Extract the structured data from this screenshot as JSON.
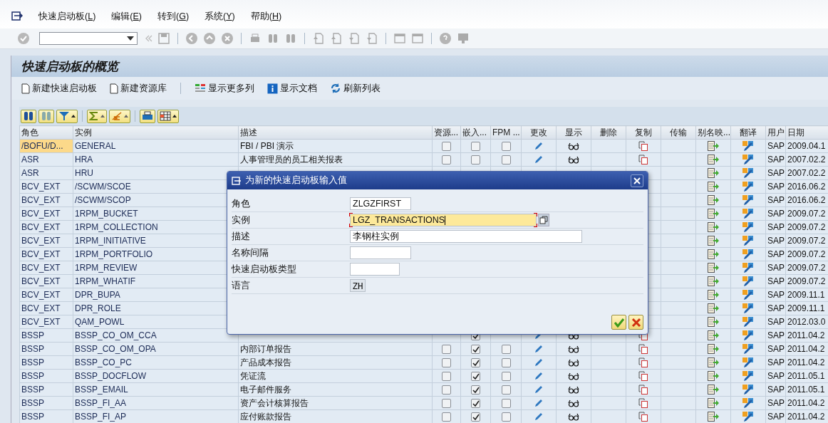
{
  "menu": [
    {
      "label": "快速启动板(L)"
    },
    {
      "label": "编辑(E)"
    },
    {
      "label": "转到(G)"
    },
    {
      "label": "系统(Y)"
    },
    {
      "label": "帮助(H)"
    }
  ],
  "title": "快速启动板的概览",
  "app_toolbar": [
    {
      "kind": "new",
      "label": "新建快速启动板"
    },
    {
      "kind": "new",
      "label": "新建资源库"
    },
    {
      "kind": "columns",
      "label": "显示更多列"
    },
    {
      "kind": "info",
      "label": "显示文档"
    },
    {
      "kind": "refresh",
      "label": "刷新列表"
    }
  ],
  "table": {
    "columns": [
      "角色",
      "实例",
      "描述",
      "资源...",
      "嵌入...",
      "FPM ...",
      "更改",
      "显示",
      "删除",
      "复制",
      "传输",
      "别名映...",
      "翻译",
      "用户",
      "日期"
    ],
    "rows": [
      {
        "role": "/BOFU/D...",
        "instance": "GENERAL",
        "description": "FBI / PBI 演示",
        "resource": false,
        "embedded": false,
        "fpm": false,
        "actions": true,
        "user": "SAP",
        "date": "2009.04.1",
        "selected": true
      },
      {
        "role": "ASR",
        "instance": "HRA",
        "description": "人事管理员的员工相关报表",
        "resource": false,
        "embedded": false,
        "fpm": false,
        "actions": true,
        "user": "SAP",
        "date": "2007.02.2",
        "selected": false
      },
      {
        "role": "ASR",
        "instance": "HRU",
        "user": "SAP",
        "date": "2007.02.2",
        "selected": false
      },
      {
        "role": "BCV_EXT",
        "instance": "/SCWM/SCOE",
        "user": "SAP",
        "date": "2016.06.2",
        "selected": false
      },
      {
        "role": "BCV_EXT",
        "instance": "/SCWM/SCOP",
        "user": "SAP",
        "date": "2016.06.2",
        "selected": false
      },
      {
        "role": "BCV_EXT",
        "instance": "1RPM_BUCKET",
        "user": "SAP",
        "date": "2009.07.2",
        "selected": false
      },
      {
        "role": "BCV_EXT",
        "instance": "1RPM_COLLECTION",
        "user": "SAP",
        "date": "2009.07.2",
        "selected": false
      },
      {
        "role": "BCV_EXT",
        "instance": "1RPM_INITIATIVE",
        "user": "SAP",
        "date": "2009.07.2",
        "selected": false
      },
      {
        "role": "BCV_EXT",
        "instance": "1RPM_PORTFOLIO",
        "user": "SAP",
        "date": "2009.07.2",
        "selected": false
      },
      {
        "role": "BCV_EXT",
        "instance": "1RPM_REVIEW",
        "user": "SAP",
        "date": "2009.07.2",
        "selected": false
      },
      {
        "role": "BCV_EXT",
        "instance": "1RPM_WHATIF",
        "user": "SAP",
        "date": "2009.07.2",
        "selected": false
      },
      {
        "role": "BCV_EXT",
        "instance": "DPR_BUPA",
        "user": "SAP",
        "date": "2009.11.1",
        "selected": false
      },
      {
        "role": "BCV_EXT",
        "instance": "DPR_ROLE",
        "user": "SAP",
        "date": "2009.11.1",
        "selected": false
      },
      {
        "role": "BCV_EXT",
        "instance": "QAM_POWL",
        "user": "SAP",
        "date": "2012.03.0",
        "selected": false
      },
      {
        "role": "BSSP",
        "instance": "BSSP_CO_OM_CCA",
        "embedded": true,
        "actions": true,
        "user": "SAP",
        "date": "2011.04.2",
        "selected": false
      },
      {
        "role": "BSSP",
        "instance": "BSSP_CO_OM_OPA",
        "description": "内部订单报告",
        "resource": false,
        "embedded": true,
        "fpm": false,
        "actions": true,
        "user": "SAP",
        "date": "2011.04.2",
        "selected": false
      },
      {
        "role": "BSSP",
        "instance": "BSSP_CO_PC",
        "description": "产品成本报告",
        "resource": false,
        "embedded": true,
        "fpm": false,
        "actions": true,
        "user": "SAP",
        "date": "2011.04.2",
        "selected": false
      },
      {
        "role": "BSSP",
        "instance": "BSSP_DOCFLOW",
        "description": "凭证流",
        "resource": false,
        "embedded": true,
        "fpm": false,
        "actions": true,
        "user": "SAP",
        "date": "2011.05.1",
        "selected": false
      },
      {
        "role": "BSSP",
        "instance": "BSSP_EMAIL",
        "description": "电子邮件服务",
        "resource": false,
        "embedded": true,
        "fpm": false,
        "actions": true,
        "user": "SAP",
        "date": "2011.05.1",
        "selected": false
      },
      {
        "role": "BSSP",
        "instance": "BSSP_FI_AA",
        "description": "资产会计核算报告",
        "resource": false,
        "embedded": true,
        "fpm": false,
        "actions": true,
        "user": "SAP",
        "date": "2011.04.2",
        "selected": false
      },
      {
        "role": "BSSP",
        "instance": "BSSP_FI_AP",
        "description": "应付账款报告",
        "resource": false,
        "embedded": true,
        "fpm": false,
        "actions": true,
        "user": "SAP",
        "date": "2011.04.2",
        "selected": false
      }
    ]
  },
  "dialog": {
    "title": "为新的快速启动板输入值",
    "fields": [
      {
        "label": "角色",
        "value": "ZLGZFIRST",
        "focused": false,
        "disabled": false
      },
      {
        "label": "实例",
        "value": "LGZ_TRANSACTIONS",
        "focused": true,
        "disabled": false
      },
      {
        "label": "描述",
        "value": "李钢柱实例",
        "focused": false,
        "disabled": false
      },
      {
        "label": "名称间隔",
        "focused": false,
        "disabled": false
      },
      {
        "label": "快速启动板类型",
        "focused": false,
        "disabled": false
      },
      {
        "label": "语言",
        "value": "ZH",
        "focused": false,
        "disabled": true
      }
    ]
  }
}
